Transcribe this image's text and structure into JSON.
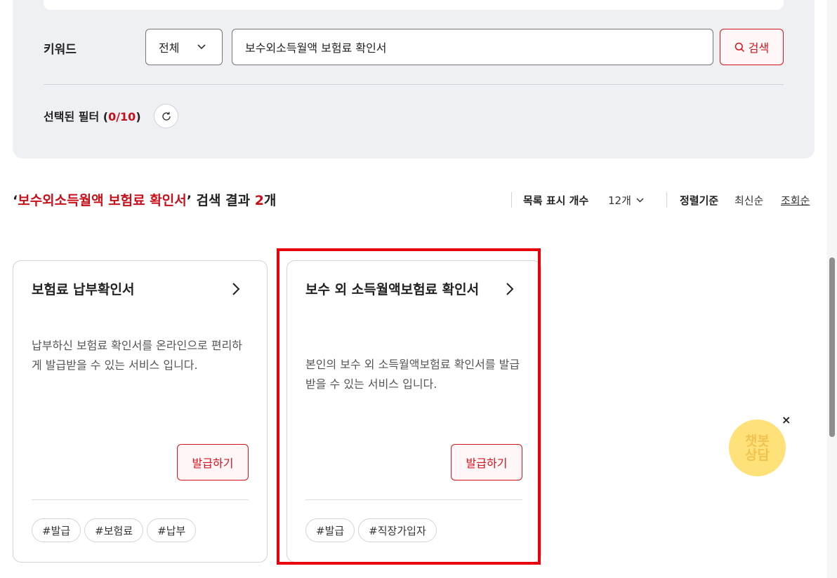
{
  "search": {
    "keyword_label": "키워드",
    "scope_selected": "전체",
    "query_value": "보수외소득월액 보험료 확인서",
    "search_button": "검색",
    "filter_label_prefix": "선택된 필터 (",
    "filter_count": "0/10",
    "filter_label_suffix": ")"
  },
  "results": {
    "quote_open": "‘",
    "query": "보수외소득월액 보험료 확인서",
    "quote_close": "’",
    "label": " 검색 결과 ",
    "count": "2",
    "unit": "개",
    "list_count_label": "목록 표시 개수",
    "list_count_value": "12개",
    "sort_label": "정렬기준",
    "sort_latest": "최신순",
    "sort_views": "조회순"
  },
  "cards": [
    {
      "title": "보험료 납부확인서",
      "description": "납부하신 보험료 확인서를 온라인으로 편리하게 발급받을 수 있는 서비스 입니다.",
      "button": "발급하기",
      "tags": [
        "#발급",
        "#보험료",
        "#납부"
      ]
    },
    {
      "title": "보수 외 소득월액보험료 확인서",
      "description": "본인의 보수 외 소득월액보험료 확인서를 발급받을 수 있는 서비스 입니다.",
      "button": "발급하기",
      "tags": [
        "#발급",
        "#직장가입자"
      ]
    }
  ],
  "chatbot": {
    "label": "챗봇상담",
    "close": "×"
  },
  "colors": {
    "accent_red": "#d6131c",
    "panel_bg": "#eef0f4",
    "chatbot_bg": "#ffe17a"
  }
}
